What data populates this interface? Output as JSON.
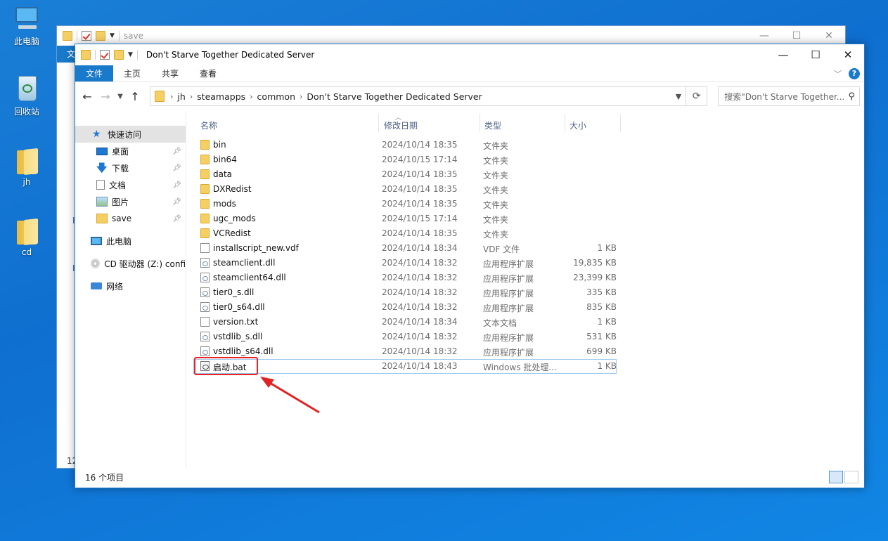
{
  "desktop": {
    "icons": [
      {
        "label": "此电脑",
        "icon": "computer-icon"
      },
      {
        "label": "回收站",
        "icon": "recycle-bin-icon"
      },
      {
        "label": "jh",
        "icon": "folder-icon"
      },
      {
        "label": "cd",
        "icon": "folder-icon"
      }
    ]
  },
  "back_window": {
    "title": "save",
    "side_fragments": [
      "文",
      "I",
      "I",
      "12"
    ]
  },
  "window": {
    "title": "Don't Starve Together Dedicated Server",
    "controls": {
      "minimize": "—",
      "maximize": "☐",
      "close": "✕"
    },
    "ribbon_tabs": [
      "文件",
      "主页",
      "共享",
      "查看"
    ],
    "help": "?",
    "address": {
      "crumbs": [
        "jh",
        "steamapps",
        "common",
        "Don't Starve Together Dedicated Server"
      ]
    },
    "search_placeholder": "搜索\"Don't Starve Together...",
    "nav": {
      "quick_access": "快速访问",
      "items": [
        {
          "label": "桌面",
          "icon": "desktop-icon",
          "pinned": true
        },
        {
          "label": "下载",
          "icon": "download-icon",
          "pinned": true
        },
        {
          "label": "文档",
          "icon": "document-icon",
          "pinned": true
        },
        {
          "label": "图片",
          "icon": "pictures-icon",
          "pinned": true
        },
        {
          "label": "save",
          "icon": "folder-icon",
          "pinned": true
        }
      ],
      "this_pc": "此电脑",
      "cd_drive": "CD 驱动器 (Z:) confi",
      "network": "网络"
    },
    "columns": {
      "name": "名称",
      "date": "修改日期",
      "type": "类型",
      "size": "大小"
    },
    "files": [
      {
        "name": "bin",
        "date": "2024/10/14 18:35",
        "type": "文件夹",
        "size": "",
        "kind": "folder"
      },
      {
        "name": "bin64",
        "date": "2024/10/15 17:14",
        "type": "文件夹",
        "size": "",
        "kind": "folder"
      },
      {
        "name": "data",
        "date": "2024/10/14 18:35",
        "type": "文件夹",
        "size": "",
        "kind": "folder"
      },
      {
        "name": "DXRedist",
        "date": "2024/10/14 18:35",
        "type": "文件夹",
        "size": "",
        "kind": "folder"
      },
      {
        "name": "mods",
        "date": "2024/10/14 18:35",
        "type": "文件夹",
        "size": "",
        "kind": "folder"
      },
      {
        "name": "ugc_mods",
        "date": "2024/10/15 17:14",
        "type": "文件夹",
        "size": "",
        "kind": "folder"
      },
      {
        "name": "VCRedist",
        "date": "2024/10/14 18:35",
        "type": "文件夹",
        "size": "",
        "kind": "folder"
      },
      {
        "name": "installscript_new.vdf",
        "date": "2024/10/14 18:34",
        "type": "VDF 文件",
        "size": "1 KB",
        "kind": "file"
      },
      {
        "name": "steamclient.dll",
        "date": "2024/10/14 18:32",
        "type": "应用程序扩展",
        "size": "19,835 KB",
        "kind": "dll"
      },
      {
        "name": "steamclient64.dll",
        "date": "2024/10/14 18:32",
        "type": "应用程序扩展",
        "size": "23,399 KB",
        "kind": "dll"
      },
      {
        "name": "tier0_s.dll",
        "date": "2024/10/14 18:32",
        "type": "应用程序扩展",
        "size": "335 KB",
        "kind": "dll"
      },
      {
        "name": "tier0_s64.dll",
        "date": "2024/10/14 18:32",
        "type": "应用程序扩展",
        "size": "835 KB",
        "kind": "dll"
      },
      {
        "name": "version.txt",
        "date": "2024/10/14 18:34",
        "type": "文本文档",
        "size": "1 KB",
        "kind": "file"
      },
      {
        "name": "vstdlib_s.dll",
        "date": "2024/10/14 18:32",
        "type": "应用程序扩展",
        "size": "531 KB",
        "kind": "dll"
      },
      {
        "name": "vstdlib_s64.dll",
        "date": "2024/10/14 18:32",
        "type": "应用程序扩展",
        "size": "699 KB",
        "kind": "dll"
      },
      {
        "name": "启动.bat",
        "date": "2024/10/14 18:43",
        "type": "Windows 批处理...",
        "size": "1 KB",
        "kind": "bat",
        "selected": true
      }
    ],
    "status": "16 个项目"
  },
  "colors": {
    "accent": "#1979ca",
    "highlight": "#e22222"
  }
}
